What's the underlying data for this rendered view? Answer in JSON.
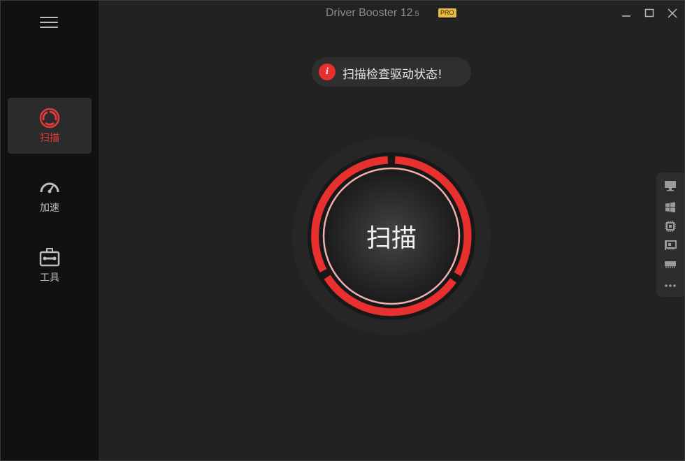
{
  "app": {
    "title": "Driver Booster 12",
    "version_suffix": ".5",
    "badge": "PRO"
  },
  "sidebar": {
    "menu_icon": "hamburger-icon",
    "items": [
      {
        "label": "扫描",
        "icon": "scan-ring-icon",
        "active": true
      },
      {
        "label": "加速",
        "icon": "speedometer-icon",
        "active": false
      },
      {
        "label": "工具",
        "icon": "toolbox-icon",
        "active": false
      }
    ]
  },
  "notice": {
    "icon": "info-icon",
    "icon_glyph": "i",
    "text": "扫描检查驱动状态!"
  },
  "scan": {
    "button_label": "扫描"
  },
  "side_tools": {
    "items": [
      "monitor-icon",
      "windows-icon",
      "chip-icon",
      "network-card-icon",
      "memory-icon",
      "more-icon"
    ]
  },
  "colors": {
    "accent": "#e8302e",
    "background": "#222222",
    "sidebar": "#111111"
  }
}
